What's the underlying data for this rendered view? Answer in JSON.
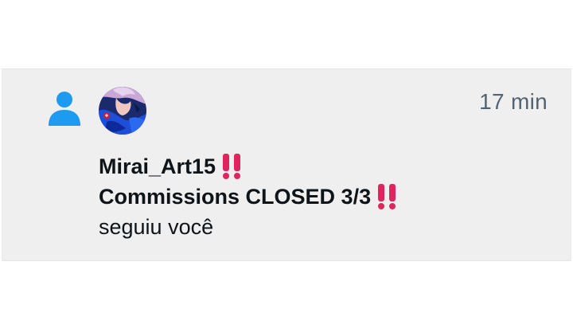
{
  "notification": {
    "timestamp": "17 min",
    "type_icon": "person-icon",
    "avatar_icon": "user-avatar",
    "user": {
      "display_name": "Mirai_Art15",
      "bio_line": "Commissions CLOSED 3/3",
      "emoji": "double-exclamation-icon"
    },
    "action_text": "seguiu você"
  },
  "colors": {
    "background": "#ffffff",
    "row_background": "#efefef",
    "accent_blue": "#1d9bf0",
    "text_primary": "#0f1419",
    "text_secondary": "#536471",
    "emoji_red": "#e0245e"
  }
}
